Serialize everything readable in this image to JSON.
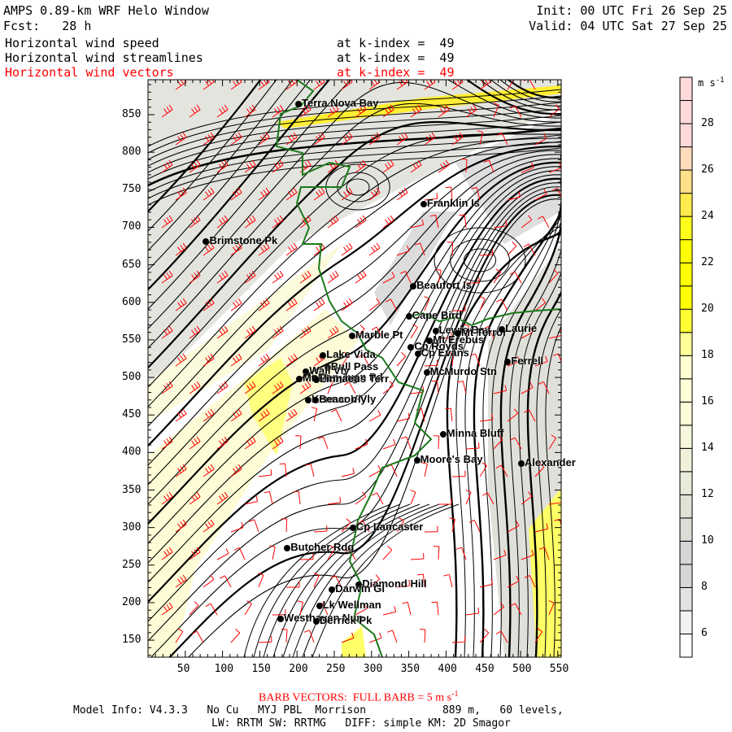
{
  "header": {
    "title": "AMPS 0.89-km WRF Helo Window",
    "init": "Init: 00 UTC Fri 26 Sep 25",
    "fcst": "Fcst:   28 h",
    "valid": "Valid: 04 UTC Sat 27 Sep 25",
    "fields": [
      {
        "name": "Horizontal wind speed",
        "level": "at k-index =  49",
        "color": "#000000"
      },
      {
        "name": "Horizontal wind streamlines",
        "level": "at k-index =  49",
        "color": "#000000"
      },
      {
        "name": "Horizontal wind vectors",
        "level": "at k-index =  49",
        "color": "#ff0000"
      }
    ]
  },
  "axes": {
    "x_ticks": [
      "50",
      "100",
      "150",
      "200",
      "250",
      "300",
      "350",
      "400",
      "450",
      "500",
      "550"
    ],
    "y_ticks": [
      "850",
      "800",
      "750",
      "700",
      "650",
      "600",
      "550",
      "500",
      "450",
      "400",
      "350",
      "300",
      "250",
      "200",
      "150"
    ],
    "xlim": [
      0,
      555
    ],
    "ylim": [
      120,
      890
    ]
  },
  "stations": [
    {
      "name": "Terra Nova Bay",
      "x": 202,
      "y": 864
    },
    {
      "name": "Franklin Is",
      "x": 370,
      "y": 731
    },
    {
      "name": "Brimstone Pk",
      "x": 78,
      "y": 681
    },
    {
      "name": "Beaufort Is",
      "x": 356,
      "y": 621
    },
    {
      "name": "Cape Bird",
      "x": 350,
      "y": 581
    },
    {
      "name": "Marble Pt",
      "x": 274,
      "y": 555
    },
    {
      "name": "Lewis Bay",
      "x": 386,
      "y": 562
    },
    {
      "name": "Mt Terror",
      "x": 416,
      "y": 559
    },
    {
      "name": "Laurie",
      "x": 475,
      "y": 564
    },
    {
      "name": "Mt Erebus",
      "x": 378,
      "y": 549
    },
    {
      "name": "Cp Royds",
      "x": 353,
      "y": 540
    },
    {
      "name": "Cp Evans",
      "x": 362,
      "y": 531
    },
    {
      "name": "Lake Vida",
      "x": 235,
      "y": 529
    },
    {
      "name": "Ferrell",
      "x": 483,
      "y": 521
    },
    {
      "name": "McMurdo Stn",
      "x": 374,
      "y": 507
    },
    {
      "name": "Bull Pass",
      "x": 241,
      "y": 513
    },
    {
      "name": "Wall Vly",
      "x": 212,
      "y": 508
    },
    {
      "name": "Don Juan Pd",
      "x": 224,
      "y": 499
    },
    {
      "name": "Mt Fleming",
      "x": 203,
      "y": 498
    },
    {
      "name": "Linnaeus Terr",
      "x": 226,
      "y": 497
    },
    {
      "name": "Kennar Vly",
      "x": 215,
      "y": 470
    },
    {
      "name": "Beacon Vly",
      "x": 225,
      "y": 470
    },
    {
      "name": "Minna Bluff",
      "x": 396,
      "y": 424
    },
    {
      "name": "Moore's Bay",
      "x": 361,
      "y": 390
    },
    {
      "name": "Alexander",
      "x": 501,
      "y": 385
    },
    {
      "name": "Cp Lancaster",
      "x": 275,
      "y": 300
    },
    {
      "name": "Butcher Rdg",
      "x": 187,
      "y": 273
    },
    {
      "name": "Diamond Hill",
      "x": 283,
      "y": 224
    },
    {
      "name": "Darwin Gl",
      "x": 247,
      "y": 217
    },
    {
      "name": "Lk Wellman",
      "x": 230,
      "y": 196
    },
    {
      "name": "Westhaven Nun",
      "x": 178,
      "y": 178
    },
    {
      "name": "Derrick Pk",
      "x": 226,
      "y": 175
    }
  ],
  "colorbar": {
    "units": "m s",
    "units_exp": "-1",
    "labels": [
      "28",
      "26",
      "24",
      "22",
      "20",
      "18",
      "16",
      "14",
      "12",
      "10",
      "8",
      "6"
    ],
    "min": 5,
    "levels": [
      "#ffffff",
      "#f2f2f2",
      "#e2e2e2",
      "#d6d6d6",
      "#d6d6d6",
      "#dcddd6",
      "#e1e2d6",
      "#e8eada",
      "#f0f1d8",
      "#f6f7dc",
      "#fdfcd8",
      "#ffffd8",
      "#ffffd2",
      "#ffff99",
      "#ffff33",
      "#ffff00",
      "#ffff00",
      "#ffff00",
      "#ffff1a",
      "#ffea4d",
      "#ffe08a",
      "#ffdabb",
      "#ffd9d9",
      "#ffd9d9",
      "#ffd9d9"
    ]
  },
  "footer": {
    "barb_note": "BARB VECTORS:  FULL BARB = 5 m s",
    "barb_exp": "-1",
    "model_info": "Model Info: V4.3.3   No Cu   MYJ PBL  Morrison            889 m,   60 levels,",
    "model_info2": "LW: RRTM SW: RRTMG   DIFF: simple KM: 2D Smagor"
  },
  "colors": {
    "coast": "#1a7a1a",
    "barb": "#ff0000",
    "streamline": "#000000"
  }
}
